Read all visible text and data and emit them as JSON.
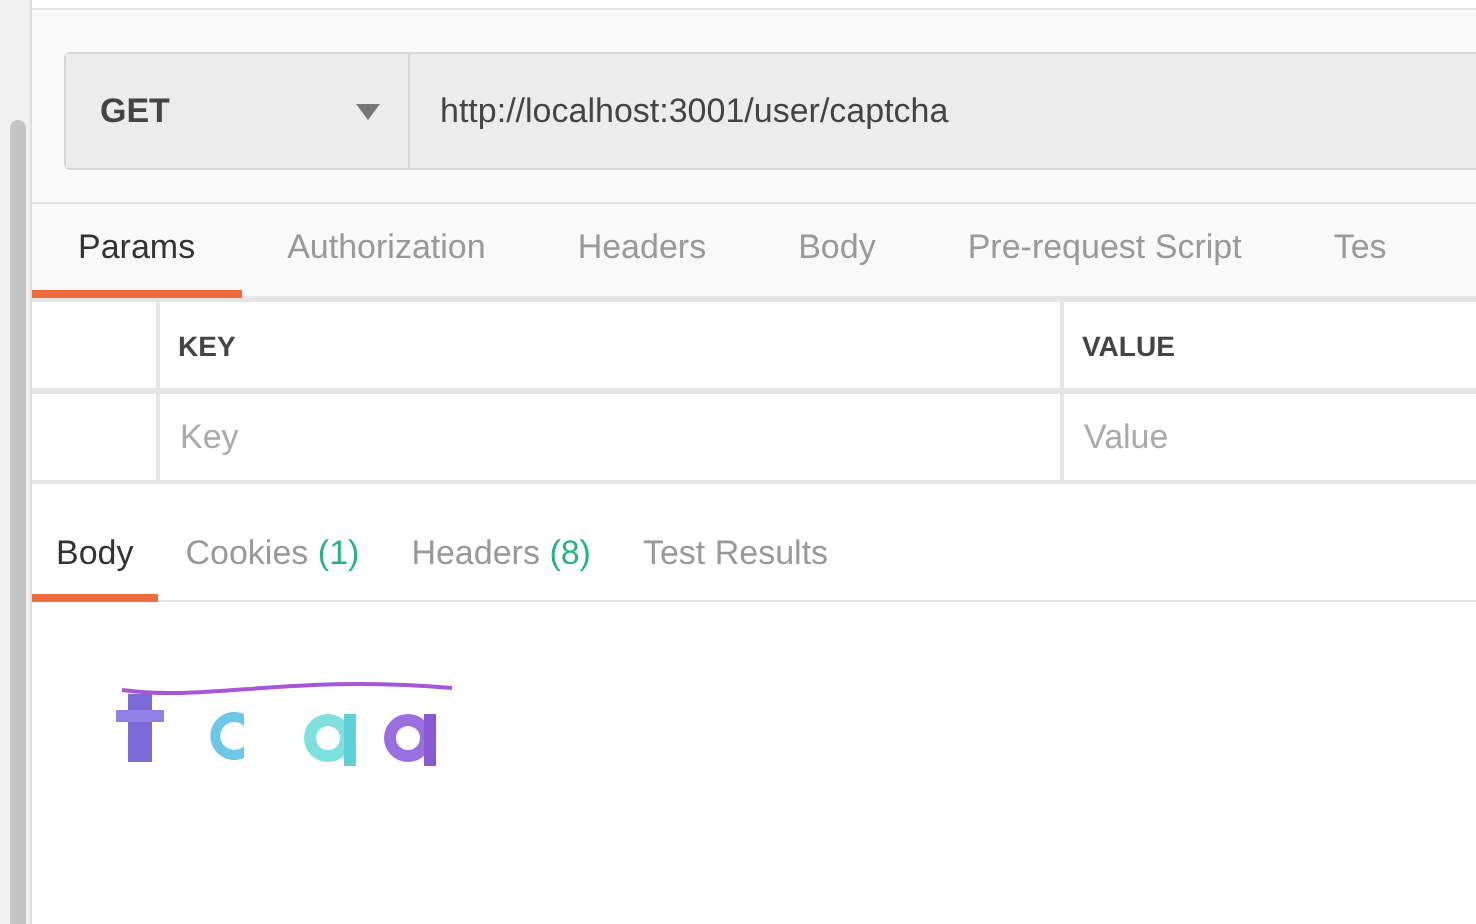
{
  "request": {
    "method": "GET",
    "url": "http://localhost:3001/user/captcha"
  },
  "request_tabs": [
    {
      "label": "Params",
      "selected": true
    },
    {
      "label": "Authorization",
      "selected": false
    },
    {
      "label": "Headers",
      "selected": false
    },
    {
      "label": "Body",
      "selected": false
    },
    {
      "label": "Pre-request Script",
      "selected": false
    },
    {
      "label": "Tes",
      "selected": false
    }
  ],
  "params_table": {
    "columns": [
      "KEY",
      "VALUE"
    ],
    "row": {
      "key_placeholder": "Key",
      "value_placeholder": "Value"
    }
  },
  "response_tabs": [
    {
      "label": "Body",
      "selected": true
    },
    {
      "label": "Cookies",
      "count": "(1)",
      "selected": false
    },
    {
      "label": "Headers",
      "count": "(8)",
      "selected": false
    },
    {
      "label": "Test Results",
      "selected": false
    }
  ]
}
